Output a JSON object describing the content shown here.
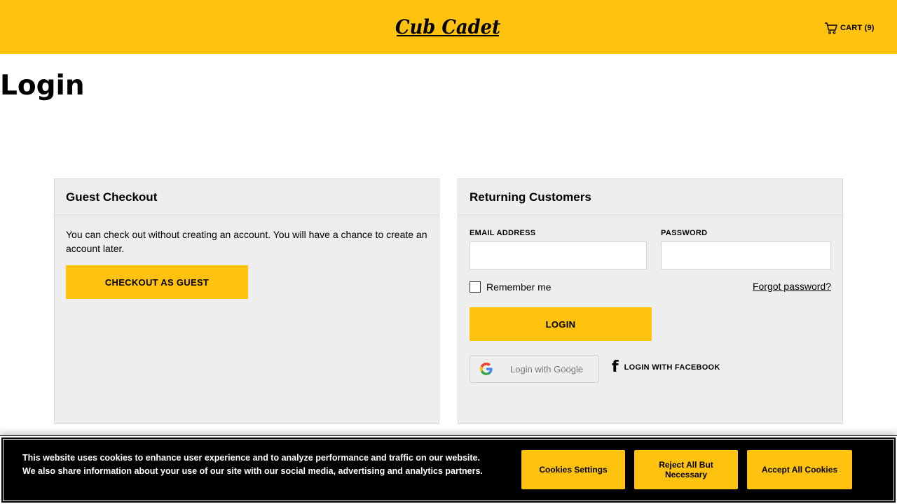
{
  "header": {
    "logo_text": "Cub Cadet",
    "cart_label": "CART (9)",
    "brand_color": "#ffc20e"
  },
  "page": {
    "title": "Login"
  },
  "guest": {
    "heading": "Guest Checkout",
    "description": "You can check out without creating an account. You will have a chance to create an account later.",
    "button_label": "CHECKOUT AS GUEST"
  },
  "returning": {
    "heading": "Returning Customers",
    "email_label": "EMAIL ADDRESS",
    "email_value": "",
    "password_label": "PASSWORD",
    "password_value": "",
    "remember_label": "Remember me",
    "remember_checked": false,
    "forgot_label": "Forgot password?",
    "login_label": "LOGIN",
    "google_label": "Login with Google",
    "facebook_label": "LOGIN WITH FACEBOOK"
  },
  "cookies": {
    "text": "This website uses cookies to enhance user experience and to analyze performance and traffic on our website. We also share information about your use of our site with our social media, advertising and analytics partners.",
    "settings_label": "Cookies Settings",
    "reject_label": "Reject All But Necessary",
    "accept_label": "Accept All Cookies"
  },
  "icons": [
    "cart-icon",
    "google-icon",
    "facebook-icon"
  ]
}
